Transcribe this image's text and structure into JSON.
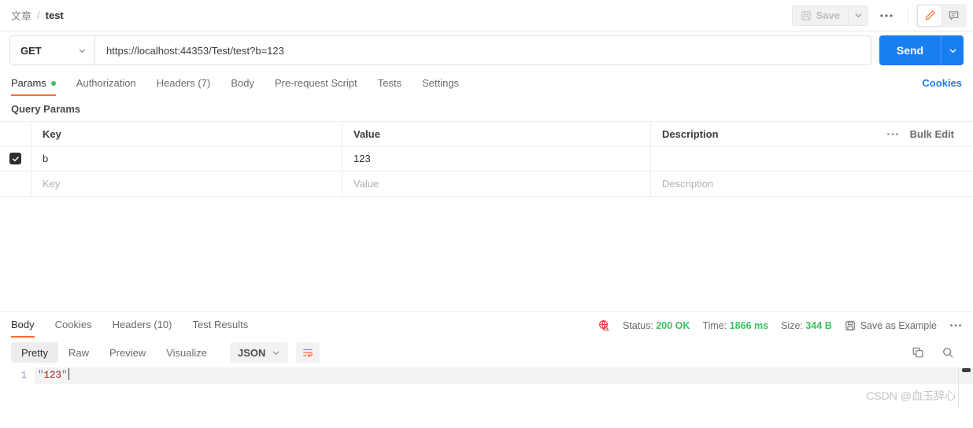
{
  "topbar": {
    "breadcrumb_folder": "文章",
    "breadcrumb_separator": "/",
    "breadcrumb_name": "test",
    "save_label": "Save",
    "save_caret": "⌄",
    "more_dots": "●●●",
    "edit_icon_name": "pencil-icon",
    "comment_icon_name": "comment-icon",
    "accent_orange": "#ff6c37"
  },
  "request": {
    "method": "GET",
    "method_caret": "⌄",
    "url": "https://localhost:44353/Test/test?b=123",
    "send_label": "Send",
    "send_caret": "⌄",
    "send_color": "#1a7ef3"
  },
  "request_tabs": [
    {
      "label": "Params",
      "active": true,
      "dot": true
    },
    {
      "label": "Authorization",
      "active": false,
      "dot": false
    },
    {
      "label": "Headers (7)",
      "active": false,
      "dot": false
    },
    {
      "label": "Body",
      "active": false,
      "dot": false
    },
    {
      "label": "Pre-request Script",
      "active": false,
      "dot": false
    },
    {
      "label": "Tests",
      "active": false,
      "dot": false
    },
    {
      "label": "Settings",
      "active": false,
      "dot": false
    }
  ],
  "cookies_link": "Cookies",
  "query_params": {
    "section_title": "Query Params",
    "headers": {
      "key": "Key",
      "value": "Value",
      "description": "Description"
    },
    "bulk_edit": "Bulk Edit",
    "header_dots": "•••",
    "rows": [
      {
        "checked": true,
        "key": "b",
        "value": "123",
        "description": ""
      }
    ],
    "placeholder_row": {
      "key": "Key",
      "value": "Value",
      "description": "Description"
    }
  },
  "response": {
    "tabs": [
      {
        "label": "Body",
        "active": true
      },
      {
        "label": "Cookies",
        "active": false
      },
      {
        "label": "Headers (10)",
        "active": false
      },
      {
        "label": "Test Results",
        "active": false
      }
    ],
    "ssl_icon_name": "ssl-warning-icon",
    "status_label": "Status:",
    "status_value": "200 OK",
    "time_label": "Time:",
    "time_value": "1866 ms",
    "size_label": "Size:",
    "size_value": "344 B",
    "save_example": "Save as Example",
    "more_dots": "•••",
    "status_color": "#3ec162"
  },
  "body_toolbar": {
    "views": [
      {
        "label": "Pretty",
        "active": true
      },
      {
        "label": "Raw",
        "active": false
      },
      {
        "label": "Preview",
        "active": false
      },
      {
        "label": "Visualize",
        "active": false
      }
    ],
    "format": "JSON",
    "format_caret": "⌄",
    "wrap_icon_name": "word-wrap-icon",
    "copy_icon_name": "copy-icon",
    "search_icon_name": "search-icon"
  },
  "editor": {
    "line_number": "1",
    "content_quote_open": "\"",
    "content_text": "123",
    "content_quote_close": "\""
  },
  "watermark": "CSDN @血玉辞心"
}
